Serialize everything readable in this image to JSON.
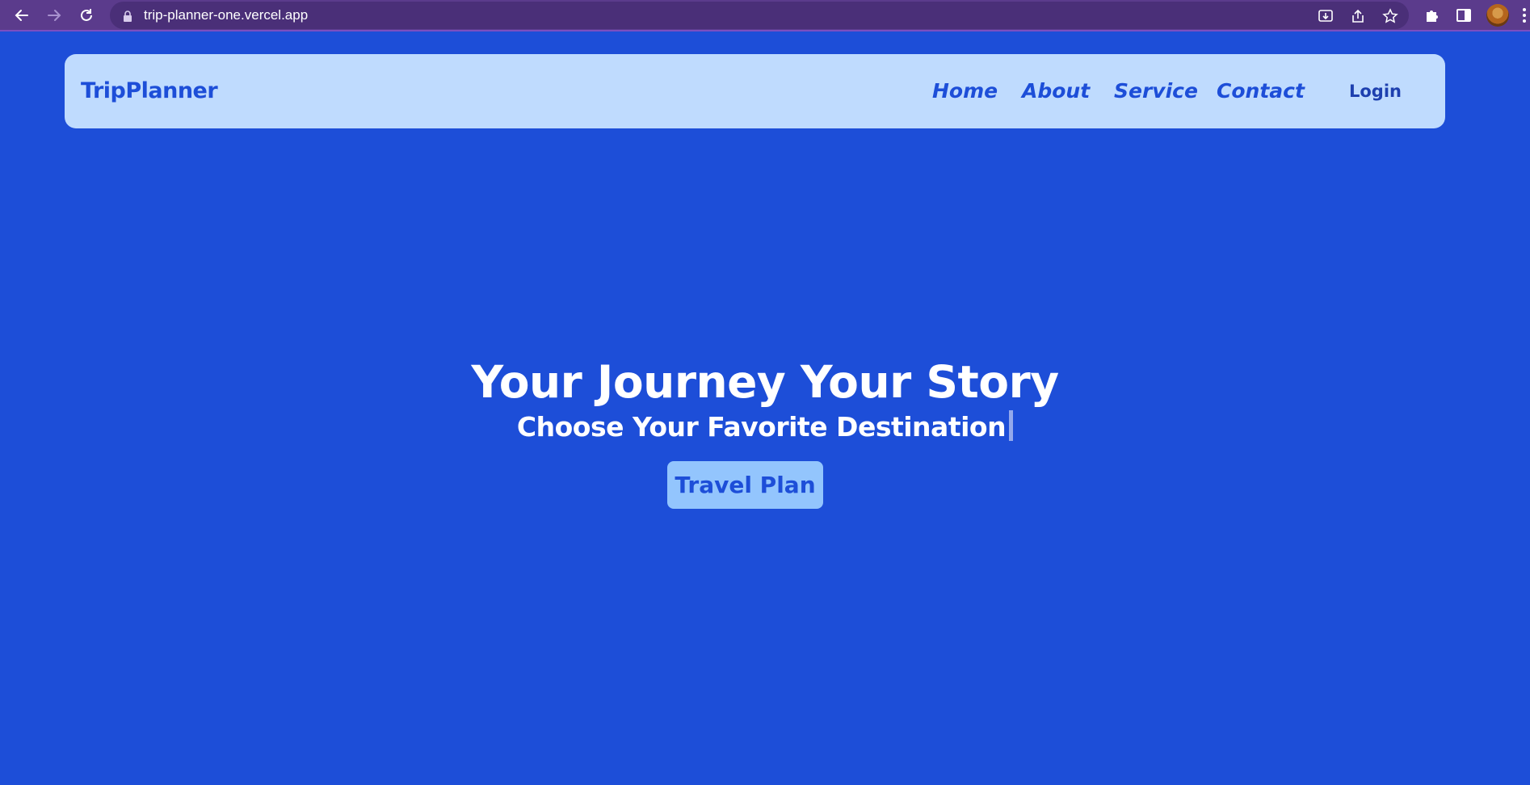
{
  "browser": {
    "url": "trip-planner-one.vercel.app",
    "icons": {
      "back": "back-arrow-icon",
      "forward": "forward-arrow-icon",
      "reload": "reload-icon",
      "lock": "lock-icon",
      "install": "install-app-icon",
      "share": "share-icon",
      "bookmark": "star-icon",
      "extensions": "puzzle-icon",
      "side_panel": "side-panel-icon",
      "menu": "kebab-menu-icon"
    }
  },
  "navbar": {
    "brand": "TripPlanner",
    "links": [
      {
        "label": "Home"
      },
      {
        "label": "About"
      },
      {
        "label": "Service"
      },
      {
        "label": "Contact"
      }
    ],
    "login": "Login"
  },
  "hero": {
    "title": "Your Journey Your Story",
    "subtitle": "Choose Your Favorite Destination",
    "cta": "Travel Plan"
  },
  "colors": {
    "page_background": "#1d4ed8",
    "navbar_background": "#bfdbfe",
    "accent_text": "#1d4ed8",
    "cta_background": "#93c5fd",
    "browser_frame": "#5b3b8c"
  }
}
